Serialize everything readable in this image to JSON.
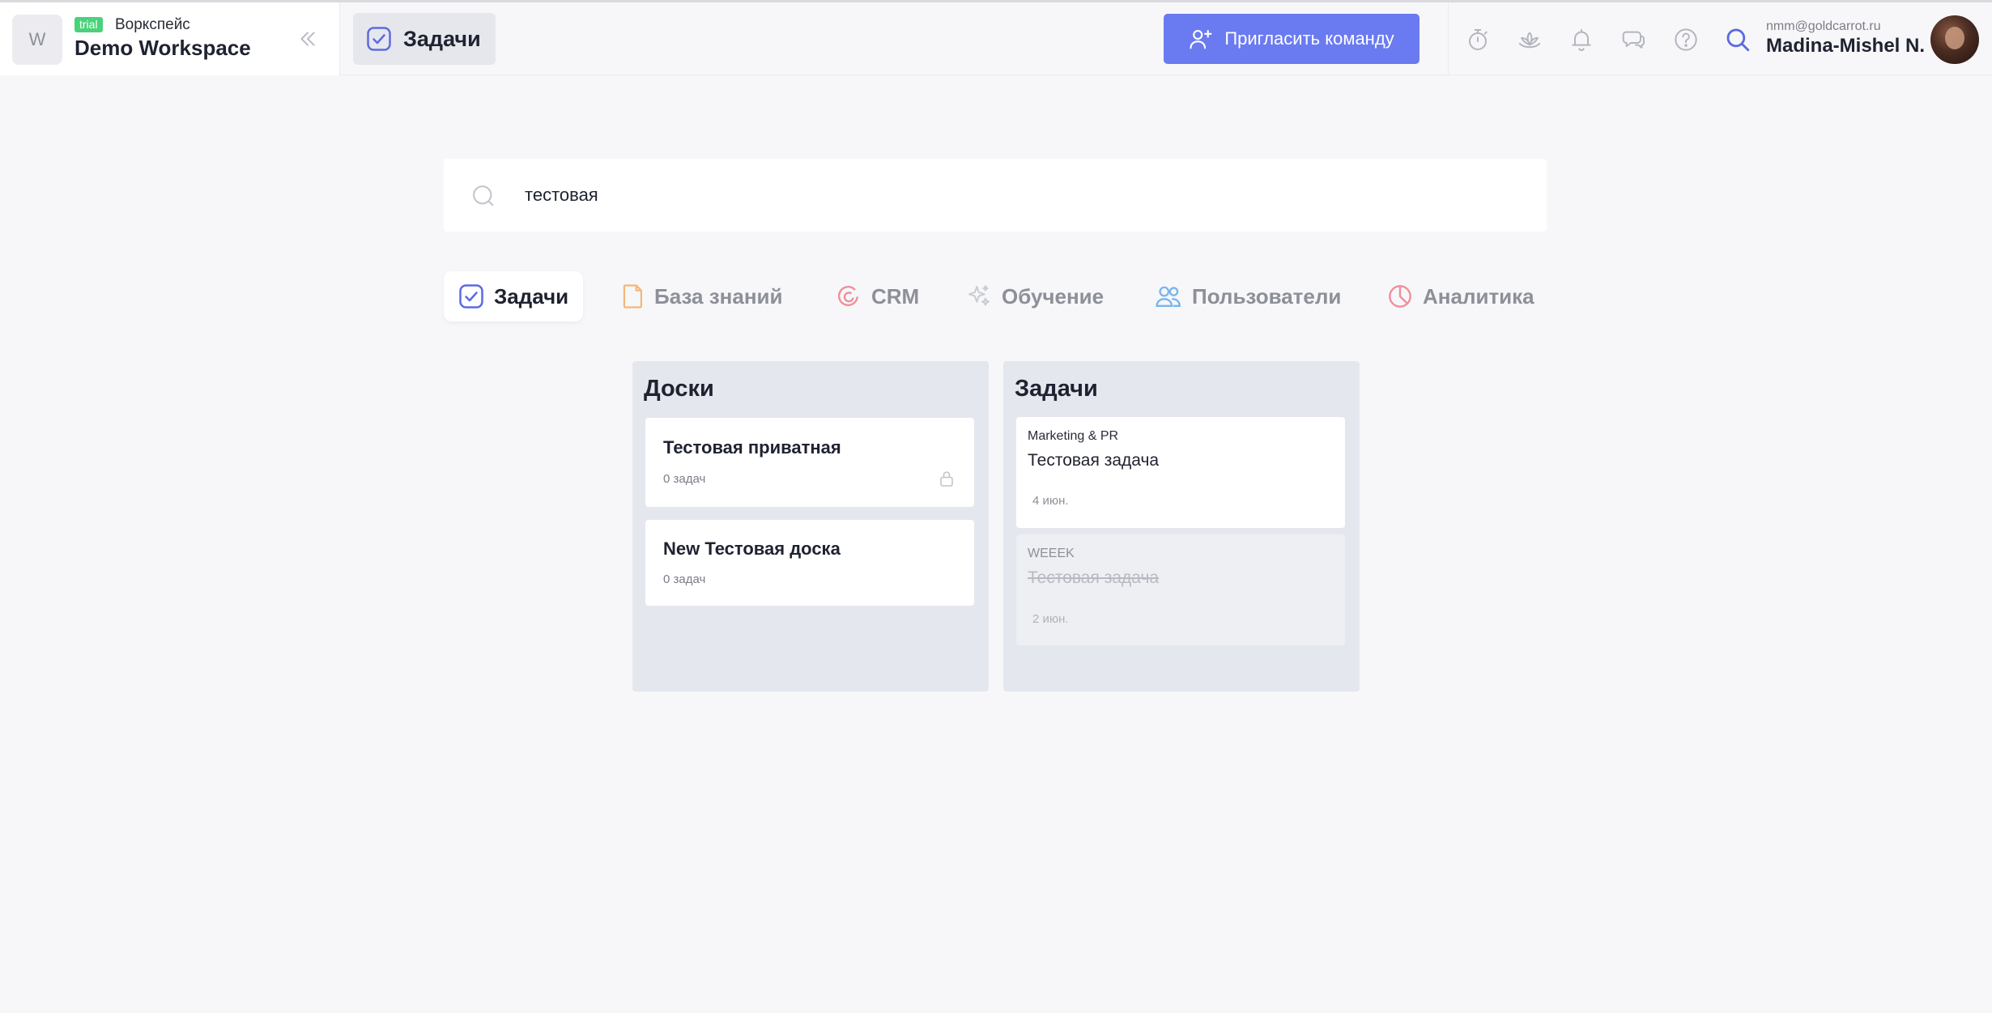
{
  "workspace": {
    "avatar_letter": "W",
    "badge": "trial",
    "label": "Воркспейс",
    "name": "Demo Workspace"
  },
  "header": {
    "active_tab": "Задачи",
    "invite_label": "Пригласить команду",
    "icons": [
      "timer-icon",
      "lotus-icon",
      "bell-icon",
      "chat-icon",
      "help-icon",
      "search-icon"
    ],
    "user_email": "nmm@goldcarrot.ru",
    "user_name": "Madina-Mishel N."
  },
  "search": {
    "value": "тестовая"
  },
  "categories": [
    {
      "label": "Задачи",
      "icon": "check-square-icon",
      "active": true
    },
    {
      "label": "База знаний",
      "icon": "document-icon",
      "active": false
    },
    {
      "label": "CRM",
      "icon": "crm-icon",
      "active": false
    },
    {
      "label": "Обучение",
      "icon": "sparkle-icon",
      "active": false
    },
    {
      "label": "Пользователи",
      "icon": "users-icon",
      "active": false
    },
    {
      "label": "Аналитика",
      "icon": "pie-icon",
      "active": false
    }
  ],
  "boards": {
    "title": "Доски",
    "items": [
      {
        "name": "Тестовая приватная",
        "count": "0 задач",
        "private": true
      },
      {
        "name": "New Тестовая доска",
        "count": "0 задач",
        "private": false
      }
    ]
  },
  "tasks": {
    "title": "Задачи",
    "items": [
      {
        "project": "Marketing & PR",
        "title": "Тестовая задача",
        "date": "4 июн.",
        "done": false
      },
      {
        "project": "WEEEK",
        "title": "Тестовая задача",
        "date": "2 июн.",
        "done": true
      }
    ]
  },
  "colors": {
    "accent": "#6a7bf1",
    "trial_badge": "#49d27a",
    "background": "#f7f7f9",
    "column_bg": "#e5e7ee"
  }
}
